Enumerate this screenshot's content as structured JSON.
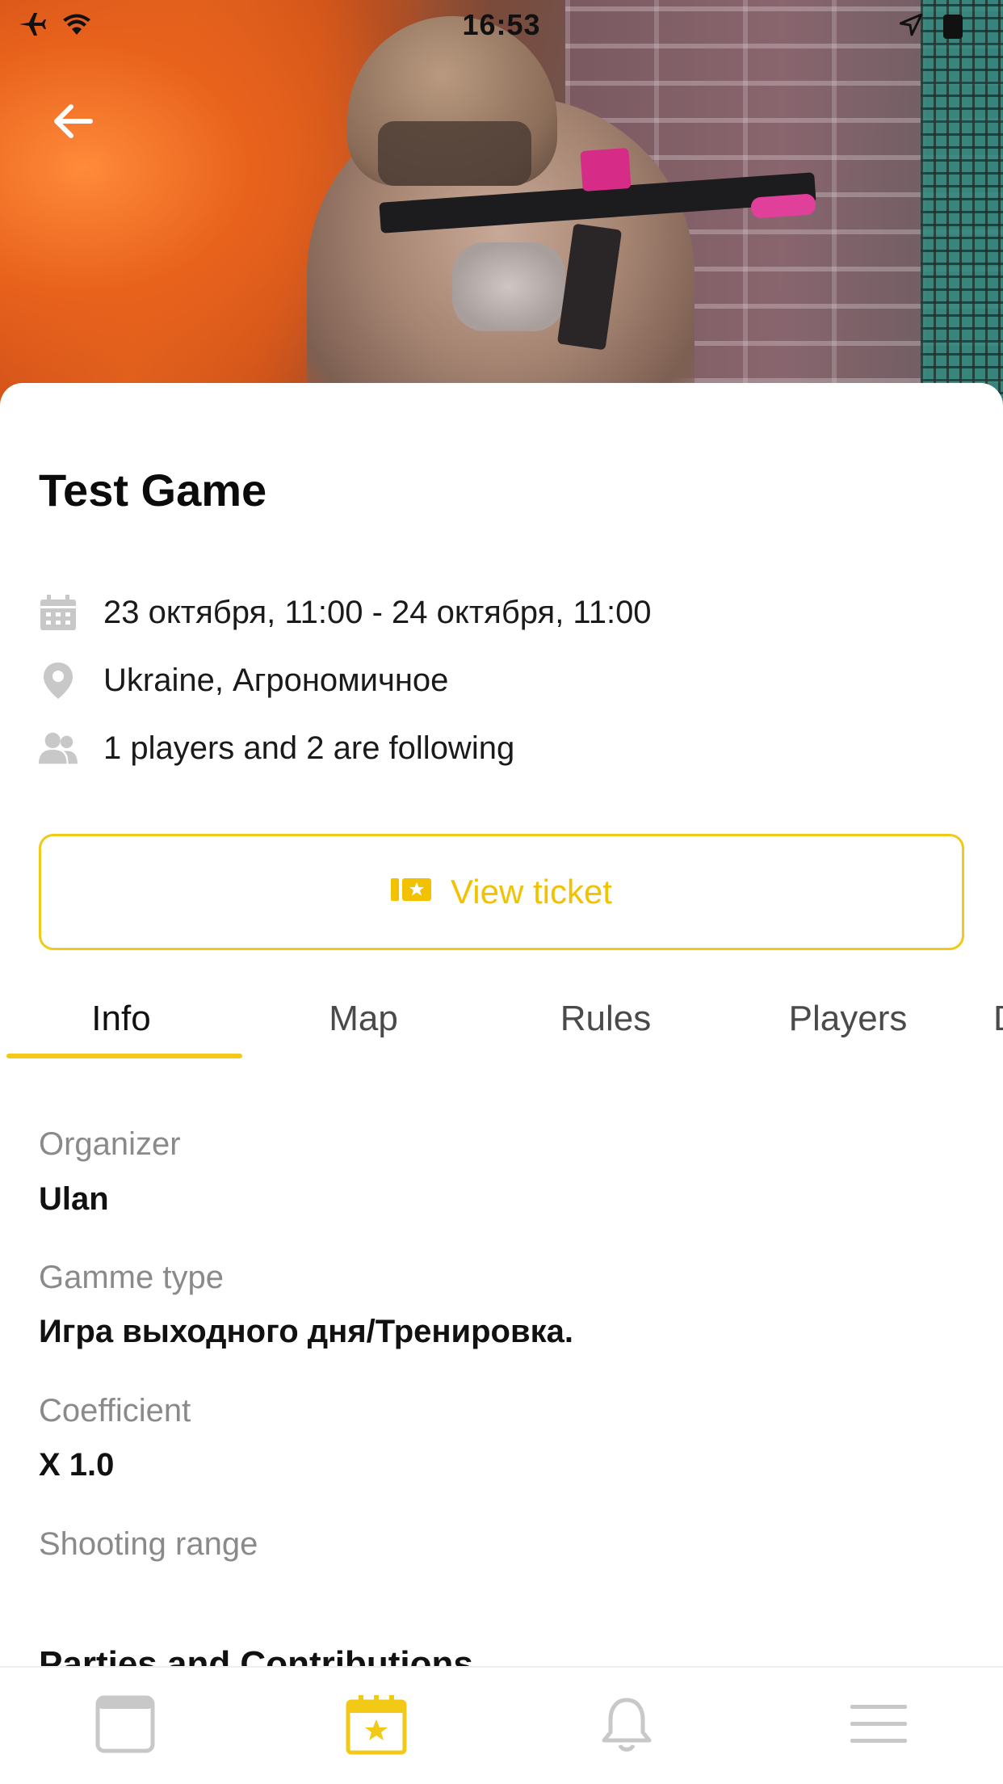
{
  "status_bar": {
    "time": "16:53",
    "left_icons": [
      "airplane-icon",
      "wifi-icon"
    ],
    "right_icons": [
      "location-arrow-icon",
      "battery-icon"
    ]
  },
  "event": {
    "title": "Test Game",
    "date": "23 октября, 11:00 - 24 октября, 11:00",
    "location": "Ukraine, Агрономичное",
    "players": "1  players and 2 are following"
  },
  "ticket_button": {
    "label": "View ticket",
    "icon": "ticket-icon"
  },
  "tabs": [
    {
      "label": "Info",
      "active": true
    },
    {
      "label": "Map",
      "active": false
    },
    {
      "label": "Rules",
      "active": false
    },
    {
      "label": "Players",
      "active": false
    },
    {
      "label": "D",
      "active": false
    }
  ],
  "info": {
    "organizer": {
      "label": "Organizer",
      "value": "Ulan"
    },
    "game_type": {
      "label": "Gamme type",
      "value": "Игра выходного дня/Тренировка."
    },
    "coefficient": {
      "label": "Coefficient",
      "value": "X 1.0"
    },
    "shooting_range": {
      "label": "Shooting range",
      "value": ""
    },
    "section_title": "Parties and Contributions"
  },
  "bottom_nav": [
    {
      "icon": "browser-window-icon",
      "active": false
    },
    {
      "icon": "calendar-star-icon",
      "active": true
    },
    {
      "icon": "bell-icon",
      "active": false
    },
    {
      "icon": "menu-icon",
      "active": false
    }
  ],
  "colors": {
    "accent": "#F2C916",
    "label_gray": "#8A8A8A",
    "icon_gray": "#C8C8C8"
  }
}
